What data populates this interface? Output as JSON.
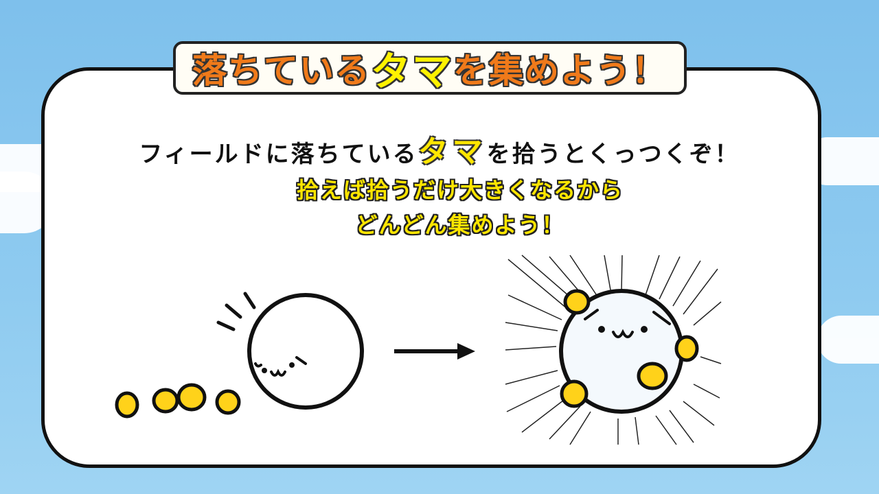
{
  "title": {
    "part1": "落ちている",
    "part2": "タマ",
    "part3": "を集めよう！"
  },
  "instruction": {
    "before": "フィールドに落ちている",
    "highlight": "タマ",
    "after": "を拾うとくっつくぞ！"
  },
  "tip": {
    "line1": "拾えば拾うだけ大きくなるから",
    "line2": "どんどん集めよう！"
  },
  "colors": {
    "sky": "#8fcbf0",
    "title_orange": "#f07a1a",
    "highlight_yellow": "#ffe600",
    "ball_yellow": "#ffd21a"
  },
  "illustration": {
    "before_state": "small-ball-with-scattered-balls",
    "after_state": "bigger-ball-with-attached-balls",
    "arrow": "arrow-right-icon"
  }
}
